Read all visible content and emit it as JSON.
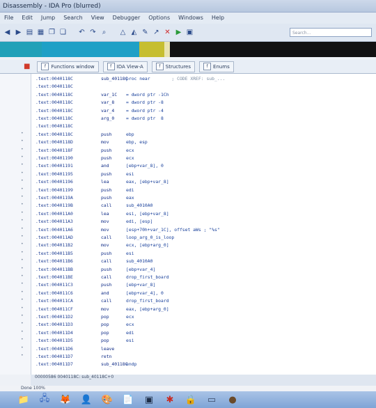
{
  "window": {
    "title": "Disassembly - IDA Pro (blurred)"
  },
  "menu": {
    "items": [
      "File",
      "Edit",
      "Jump",
      "Search",
      "View",
      "Debugger",
      "Options",
      "Windows",
      "Help"
    ]
  },
  "toolbar": {
    "search_placeholder": "Search..."
  },
  "nav_band": {
    "segments": [
      {
        "color": "#22a1b8",
        "w": 60
      },
      {
        "color": "#1fa0c6",
        "w": 140
      },
      {
        "color": "#c6be30",
        "w": 36
      },
      {
        "color": "#e9e3b0",
        "w": 8
      },
      {
        "color": "#121212",
        "w": 296
      }
    ]
  },
  "tabs": [
    {
      "label": "Functions window",
      "icon": "function-icon"
    },
    {
      "label": "IDA View-A",
      "icon": "view-icon"
    },
    {
      "label": "Structures",
      "icon": "structure-icon"
    },
    {
      "label": "Enums",
      "icon": "enum-icon"
    }
  ],
  "code_lines": [
    {
      "addr": ".text:0040118C",
      "mn": "sub_40118C",
      "op": "proc near",
      "cmt": "; CODE XREF: sub_..."
    },
    {
      "addr": ".text:0040118C",
      "mn": "",
      "op": ""
    },
    {
      "addr": ".text:0040118C",
      "mn": "var_1C",
      "op": "= dword ptr -1Ch"
    },
    {
      "addr": ".text:0040118C",
      "mn": "var_8",
      "op": "= dword ptr -8"
    },
    {
      "addr": ".text:0040118C",
      "mn": "var_4",
      "op": "= dword ptr -4"
    },
    {
      "addr": ".text:0040118C",
      "mn": "arg_0",
      "op": "= dword ptr  8"
    },
    {
      "addr": ".text:0040118C",
      "mn": "",
      "op": ""
    },
    {
      "addr": ".text:0040118C",
      "mn": "push",
      "op": "ebp"
    },
    {
      "addr": ".text:0040118D",
      "mn": "mov",
      "op": "ebp, esp"
    },
    {
      "addr": ".text:0040118F",
      "mn": "push",
      "op": "ecx"
    },
    {
      "addr": ".text:00401190",
      "mn": "push",
      "op": "ecx"
    },
    {
      "addr": ".text:00401191",
      "mn": "and",
      "op": "[ebp+var_8], 0"
    },
    {
      "addr": ".text:00401195",
      "mn": "push",
      "op": "esi"
    },
    {
      "addr": ".text:00401196",
      "mn": "lea",
      "op": "eax, [ebp+var_8]"
    },
    {
      "addr": ".text:00401199",
      "mn": "push",
      "op": "edi"
    },
    {
      "addr": ".text:0040119A",
      "mn": "push",
      "op": "eax"
    },
    {
      "addr": ".text:0040119B",
      "mn": "call",
      "op": "sub_4010A0"
    },
    {
      "addr": ".text:004011A0",
      "mn": "lea",
      "op": "esi, [ebp+var_8]"
    },
    {
      "addr": ".text:004011A3",
      "mn": "mov",
      "op": "edi, [esp]"
    },
    {
      "addr": ".text:004011A6",
      "mn": "mov",
      "op": "[esp+70h+var_1C], offset aWs ; \"%s\""
    },
    {
      "addr": ".text:004011AD",
      "mn": "call",
      "op": "loop_arg_0_is_loop"
    },
    {
      "addr": ".text:004011B2",
      "mn": "mov",
      "op": "ecx, [ebp+arg_0]"
    },
    {
      "addr": ".text:004011B5",
      "mn": "push",
      "op": "esi"
    },
    {
      "addr": ".text:004011B6",
      "mn": "call",
      "op": "sub_4010A0"
    },
    {
      "addr": ".text:004011BB",
      "mn": "push",
      "op": "[ebp+var_4]"
    },
    {
      "addr": ".text:004011BE",
      "mn": "call",
      "op": "drop_first_board"
    },
    {
      "addr": ".text:004011C3",
      "mn": "push",
      "op": "[ebp+var_8]"
    },
    {
      "addr": ".text:004011C6",
      "mn": "and",
      "op": "[ebp+var_4], 0"
    },
    {
      "addr": ".text:004011CA",
      "mn": "call",
      "op": "drop_first_board"
    },
    {
      "addr": ".text:004011CF",
      "mn": "mov",
      "op": "eax, [ebp+arg_0]"
    },
    {
      "addr": ".text:004011D2",
      "mn": "pop",
      "op": "ecx"
    },
    {
      "addr": ".text:004011D3",
      "mn": "pop",
      "op": "ecx"
    },
    {
      "addr": ".text:004011D4",
      "mn": "pop",
      "op": "edi"
    },
    {
      "addr": ".text:004011D5",
      "mn": "pop",
      "op": "esi"
    },
    {
      "addr": ".text:004011D6",
      "mn": "leave",
      "op": ""
    },
    {
      "addr": ".text:004011D7",
      "mn": "retn",
      "op": ""
    },
    {
      "addr": ".text:004011D7",
      "mn": "sub_40118C",
      "op": "endp"
    }
  ],
  "status": {
    "line1": "00000586 0040118C: sub_40118C+0",
    "line2": "Done 100%"
  },
  "taskbar": {
    "icons": [
      {
        "name": "folder-icon",
        "glyph": "📁",
        "color": "#e8c04a"
      },
      {
        "name": "network-icon",
        "glyph": "🖧",
        "color": "#3a6ac2"
      },
      {
        "name": "firefox-icon",
        "glyph": "🦊",
        "color": "#e0561a"
      },
      {
        "name": "user-icon",
        "glyph": "👤",
        "color": "#4a6aa8"
      },
      {
        "name": "paint-icon",
        "glyph": "🎨",
        "color": "#4aa0d8"
      },
      {
        "name": "document-icon",
        "glyph": "📄",
        "color": "#2a4a8a"
      },
      {
        "name": "terminal-icon",
        "glyph": "▣",
        "color": "#1e2e48"
      },
      {
        "name": "bug-icon",
        "glyph": "✱",
        "color": "#c82a22"
      },
      {
        "name": "lock-icon",
        "glyph": "🔒",
        "color": "#3a6ac2"
      },
      {
        "name": "window-icon",
        "glyph": "▭",
        "color": "#3a4a68"
      },
      {
        "name": "avatar-icon",
        "glyph": "●",
        "color": "#6a4a2a"
      }
    ]
  }
}
